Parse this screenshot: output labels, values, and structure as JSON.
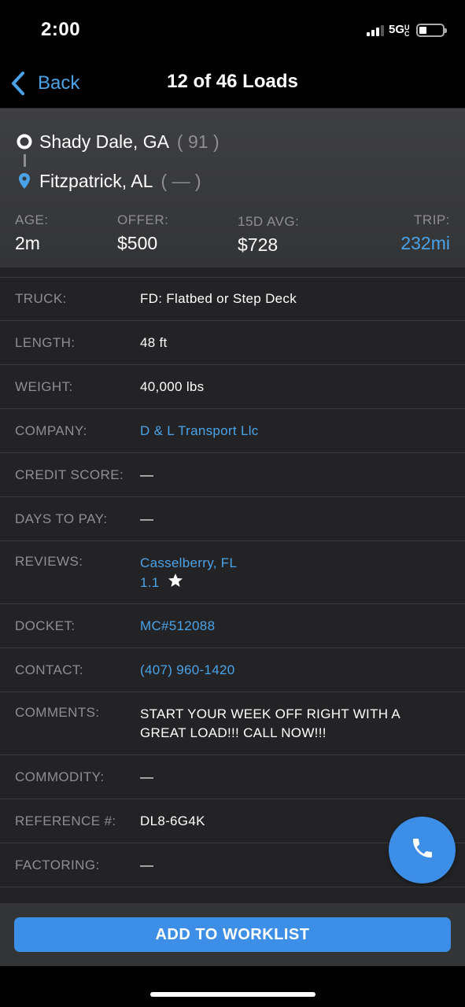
{
  "status_bar": {
    "time": "2:00",
    "network": "5G",
    "network_suffix": "UC"
  },
  "nav": {
    "back_label": "Back",
    "title": "12 of 46 Loads"
  },
  "route": {
    "origin": {
      "city": "Shady Dale, GA",
      "extra": "( 91 )"
    },
    "destination": {
      "city": "Fitzpatrick, AL",
      "extra": "( — )"
    }
  },
  "stats": {
    "age": {
      "label": "AGE:",
      "value": "2m"
    },
    "offer": {
      "label": "OFFER:",
      "value": "$500"
    },
    "avg": {
      "label": "15D AVG:",
      "value": "$728"
    },
    "trip": {
      "label": "TRIP:",
      "value": "232mi"
    }
  },
  "details": {
    "truck": {
      "label": "TRUCK:",
      "value": "FD: Flatbed or Step Deck"
    },
    "length": {
      "label": "LENGTH:",
      "value": "48 ft"
    },
    "weight": {
      "label": "WEIGHT:",
      "value": "40,000 lbs"
    },
    "company": {
      "label": "COMPANY:",
      "value": "D & L Transport Llc"
    },
    "credit_score": {
      "label": "CREDIT SCORE:",
      "value": "—"
    },
    "days_to_pay": {
      "label": "DAYS TO PAY:",
      "value": "—"
    },
    "reviews": {
      "label": "REVIEWS:",
      "location": "Casselberry, FL",
      "rating": "1.1"
    },
    "docket": {
      "label": "DOCKET:",
      "value": "MC#512088"
    },
    "contact": {
      "label": "CONTACT:",
      "value": "(407) 960-1420"
    },
    "comments": {
      "label": "COMMENTS:",
      "value": "START YOUR WEEK OFF RIGHT WITH A GREAT LOAD!!! CALL NOW!!!"
    },
    "commodity": {
      "label": "COMMODITY:",
      "value": "—"
    },
    "reference": {
      "label": "REFERENCE #:",
      "value": "DL8-6G4K"
    },
    "factoring": {
      "label": "FACTORING:",
      "value": "—"
    }
  },
  "footer": {
    "add_to_worklist_label": "ADD TO WORKLIST"
  },
  "colors": {
    "accent": "#4aa3e8",
    "button": "#3d8ee6",
    "muted": "#8e8e93"
  },
  "icons": [
    "origin-circle-icon",
    "location-pin-icon",
    "back-chevron-icon",
    "phone-icon",
    "star-icon",
    "signal-icon",
    "battery-icon"
  ]
}
